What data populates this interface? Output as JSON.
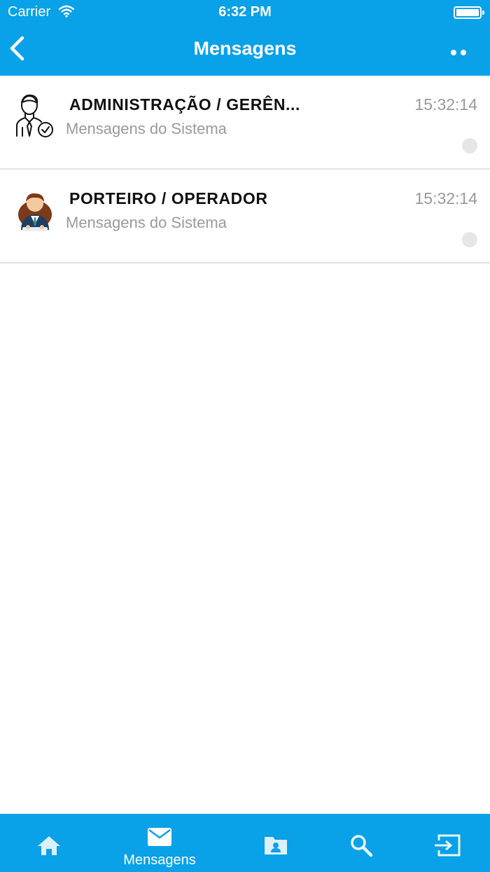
{
  "status_bar": {
    "carrier": "Carrier",
    "time": "6:32 PM"
  },
  "nav": {
    "title": "Mensagens"
  },
  "messages": [
    {
      "title": "ADMINISTRAÇÃO / GERÊN...",
      "subtitle": "Mensagens do Sistema",
      "time": "15:32:14",
      "avatar_icon": "manager-avatar-icon"
    },
    {
      "title": "PORTEIRO / OPERADOR",
      "subtitle": "Mensagens do Sistema",
      "time": "15:32:14",
      "avatar_icon": "doorman-avatar-icon"
    }
  ],
  "tab_bar": {
    "active_index": 1,
    "tabs": [
      {
        "icon": "home-icon",
        "label": ""
      },
      {
        "icon": "mail-icon",
        "label": "Mensagens"
      },
      {
        "icon": "contacts-folder-icon",
        "label": ""
      },
      {
        "icon": "search-icon",
        "label": ""
      },
      {
        "icon": "logout-icon",
        "label": ""
      }
    ]
  },
  "colors": {
    "primary": "#09a1e7",
    "separator": "#e3e3e3",
    "muted_text": "#9a9a9a",
    "unread_dot": "#e6e6e6"
  }
}
